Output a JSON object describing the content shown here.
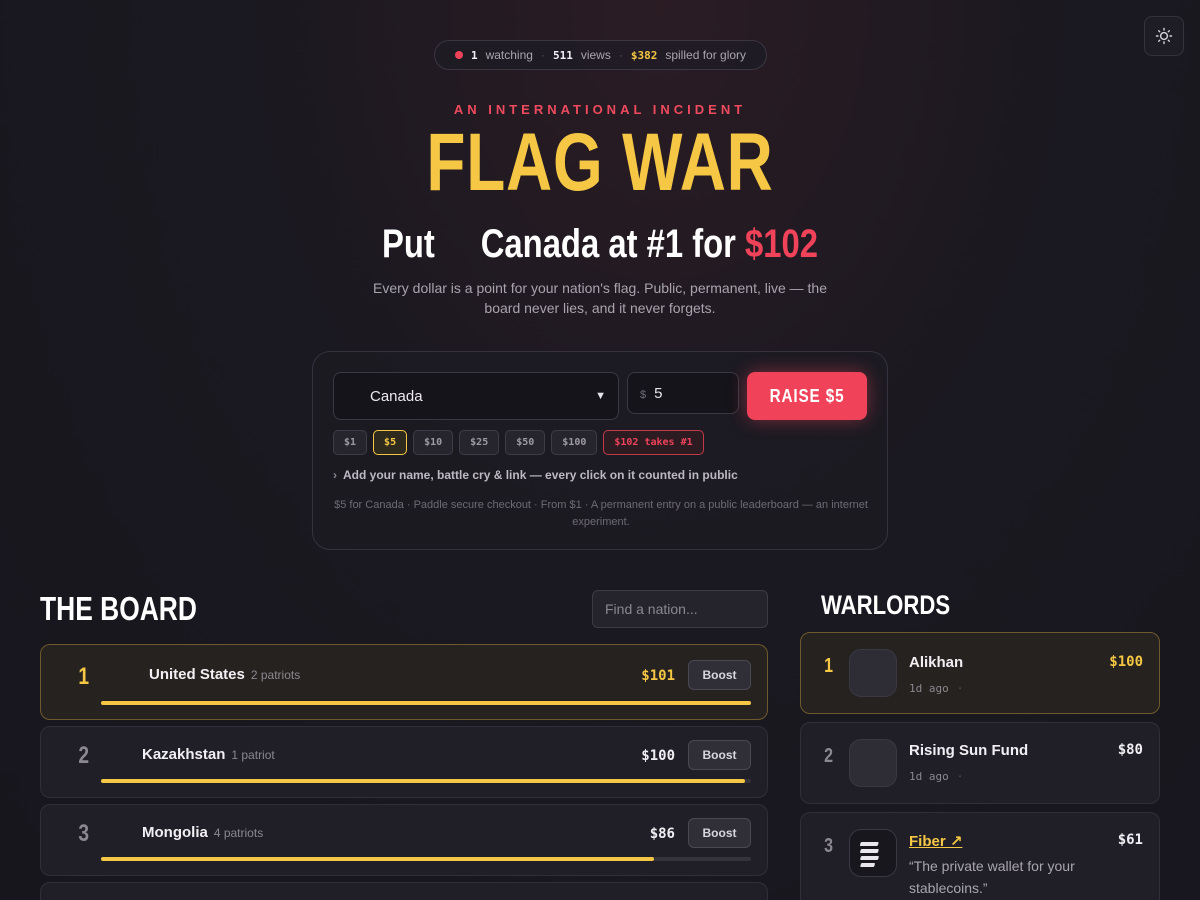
{
  "stats": {
    "watching_count": "1",
    "watching_label": "watching",
    "views_count": "511",
    "views_label": "views",
    "spilled_amount": "$382",
    "spilled_label": "spilled for glory"
  },
  "hero": {
    "eyebrow": "AN INTERNATIONAL INCIDENT",
    "title": "FLAG WAR",
    "headline_start": "Put",
    "headline_country": "Canada at #1 for",
    "headline_price": "$102",
    "subtitle": "Every dollar is a point for your nation's flag. Public, permanent, live — the board never lies, and it never forgets."
  },
  "form": {
    "country_selected": "Canada",
    "currency_symbol": "$",
    "amount_value": "5",
    "raise_label": "RAISE $5",
    "chips": [
      "$1",
      "$5",
      "$10",
      "$25",
      "$50",
      "$100"
    ],
    "active_chip": "$5",
    "take_chip": "$102 takes #1",
    "details_label": "Add your name, battle cry & link — every click on it counted in public",
    "fineprint": "$5 for Canada · Paddle secure checkout · From $1 · A permanent entry on a public leaderboard — an internet experiment."
  },
  "board": {
    "title": "THE BOARD",
    "search_placeholder": "Find a nation...",
    "boost_label": "Boost",
    "rows": [
      {
        "rank": "1",
        "country": "United States",
        "patriots": "2 patriots",
        "total": "$101",
        "progress": 1.0
      },
      {
        "rank": "2",
        "country": "Kazakhstan",
        "patriots": "1 patriot",
        "total": "$100",
        "progress": 0.99
      },
      {
        "rank": "3",
        "country": "Mongolia",
        "patriots": "4 patriots",
        "total": "$86",
        "progress": 0.85
      }
    ]
  },
  "warlords": {
    "title": "WARLORDS",
    "rows": [
      {
        "rank": "1",
        "name": "Alikhan",
        "time": "1d ago",
        "amount": "$100"
      },
      {
        "rank": "2",
        "name": "Rising Sun Fund",
        "time": "1d ago",
        "amount": "$80"
      },
      {
        "rank": "3",
        "name": "Fiber ↗",
        "quote": "“The private wallet for your stablecoins.”",
        "amount": "$61"
      }
    ]
  },
  "colors": {
    "accent_gold": "#f5c744",
    "accent_red": "#f0435a",
    "background": "#17161d"
  },
  "icons": {
    "theme_toggle": "sun-icon",
    "live_indicator": "red-dot",
    "warlord_3_logo": "fiber-logo-icon"
  }
}
